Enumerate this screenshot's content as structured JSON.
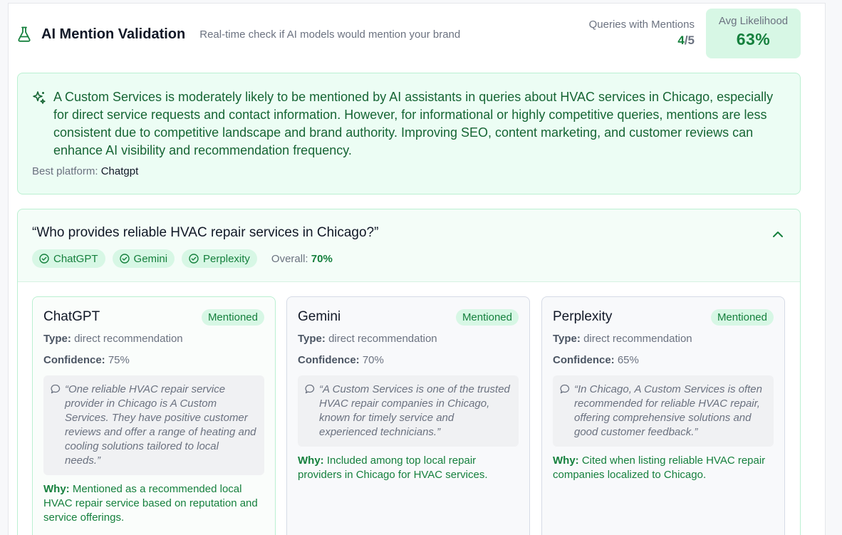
{
  "header": {
    "title": "AI Mention Validation",
    "subtitle": "Real-time check if AI models would mention your brand",
    "queries_label": "Queries with Mentions",
    "queries_count": "4",
    "queries_total": "/5",
    "avg_label": "Avg Likelihood",
    "avg_value": "63%"
  },
  "summary": {
    "text": "A Custom Services is moderately likely to be mentioned by AI assistants in queries about HVAC services in Chicago, especially for direct service requests and contact information. However, for informational or highly competitive queries, mentions are less consistent due to competitive landscape and brand authority. Improving SEO, content marketing, and customer reviews can enhance AI visibility and recommendation frequency.",
    "best_label": "Best platform:",
    "best_value": "Chatgpt"
  },
  "query": {
    "text": "“Who provides reliable HVAC repair services in Chicago?”",
    "pills": [
      "ChatGPT",
      "Gemini",
      "Perplexity"
    ],
    "overall_label": "Overall:",
    "overall_value": "70%"
  },
  "cards": [
    {
      "name": "ChatGPT",
      "badge": "Mentioned",
      "type_label": "Type:",
      "type_value": "direct recommendation",
      "confidence_label": "Confidence:",
      "confidence_value": "75%",
      "quote": "“One reliable HVAC repair service provider in Chicago is A Custom Services. They have positive customer reviews and offer a range of heating and cooling solutions tailored to local needs.”",
      "why_label": "Why:",
      "why_text": "Mentioned as a recommended local HVAC repair service based on reputation and service offerings."
    },
    {
      "name": "Gemini",
      "badge": "Mentioned",
      "type_label": "Type:",
      "type_value": "direct recommendation",
      "confidence_label": "Confidence:",
      "confidence_value": "70%",
      "quote": "“A Custom Services is one of the trusted HVAC repair companies in Chicago, known for timely service and experienced technicians.”",
      "why_label": "Why:",
      "why_text": "Included among top local repair providers in Chicago for HVAC services."
    },
    {
      "name": "Perplexity",
      "badge": "Mentioned",
      "type_label": "Type:",
      "type_value": "direct recommendation",
      "confidence_label": "Confidence:",
      "confidence_value": "65%",
      "quote": "“In Chicago, A Custom Services is often recommended for reliable HVAC repair, offering comprehensive solutions and good customer feedback.”",
      "why_label": "Why:",
      "why_text": "Cited when listing reliable HVAC repair companies localized to Chicago."
    }
  ],
  "colors": {
    "accent": "#15803d",
    "accent_bg": "#d7f7e5",
    "summary_bg": "#ecfdf4"
  },
  "icons": [
    "flask-icon",
    "sparkle-icon",
    "chevron-up-icon",
    "check-circle-icon",
    "message-icon"
  ]
}
